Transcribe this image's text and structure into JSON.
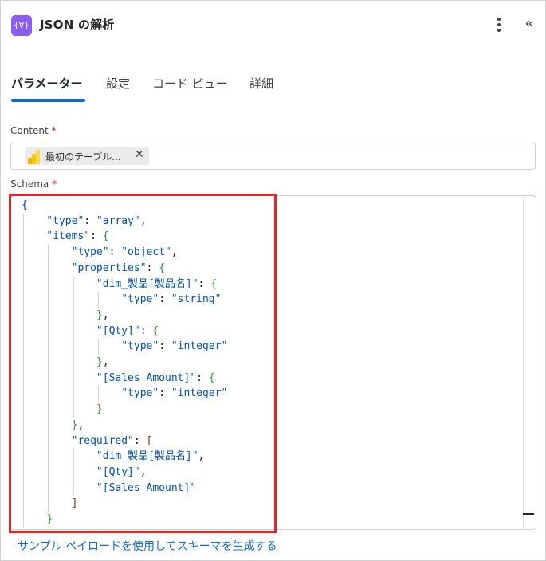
{
  "header": {
    "icon_glyph": "{∀}",
    "title": "JSON の解析"
  },
  "tabs": [
    {
      "label": "パラメーター",
      "active": true
    },
    {
      "label": "設定",
      "active": false
    },
    {
      "label": "コード ビュー",
      "active": false
    },
    {
      "label": "詳細",
      "active": false
    }
  ],
  "content": {
    "label": "Content",
    "required_mark": "*",
    "token_label": "最初のテーブル...",
    "token_close": "✕"
  },
  "schema": {
    "label": "Schema",
    "required_mark": "*",
    "lines": [
      "{",
      "    \"type\": \"array\",",
      "    \"items\": {",
      "        \"type\": \"object\",",
      "        \"properties\": {",
      "            \"dim_製品[製品名]\": {",
      "                \"type\": \"string\"",
      "            },",
      "            \"[Qty]\": {",
      "                \"type\": \"integer\"",
      "            },",
      "            \"[Sales Amount]\": {",
      "                \"type\": \"integer\"",
      "            }",
      "        },",
      "        \"required\": [",
      "            \"dim_製品[製品名]\",",
      "            \"[Qty]\",",
      "            \"[Sales Amount]\"",
      "        ]",
      "    }"
    ]
  },
  "footer": {
    "link_label": "サンプル ペイロードを使用してスキーマを生成する"
  },
  "colors": {
    "accent": "#0f6cbd",
    "highlight": "#e3262a",
    "app_icon": "#8b5cf6",
    "required": "#c50f1f"
  }
}
